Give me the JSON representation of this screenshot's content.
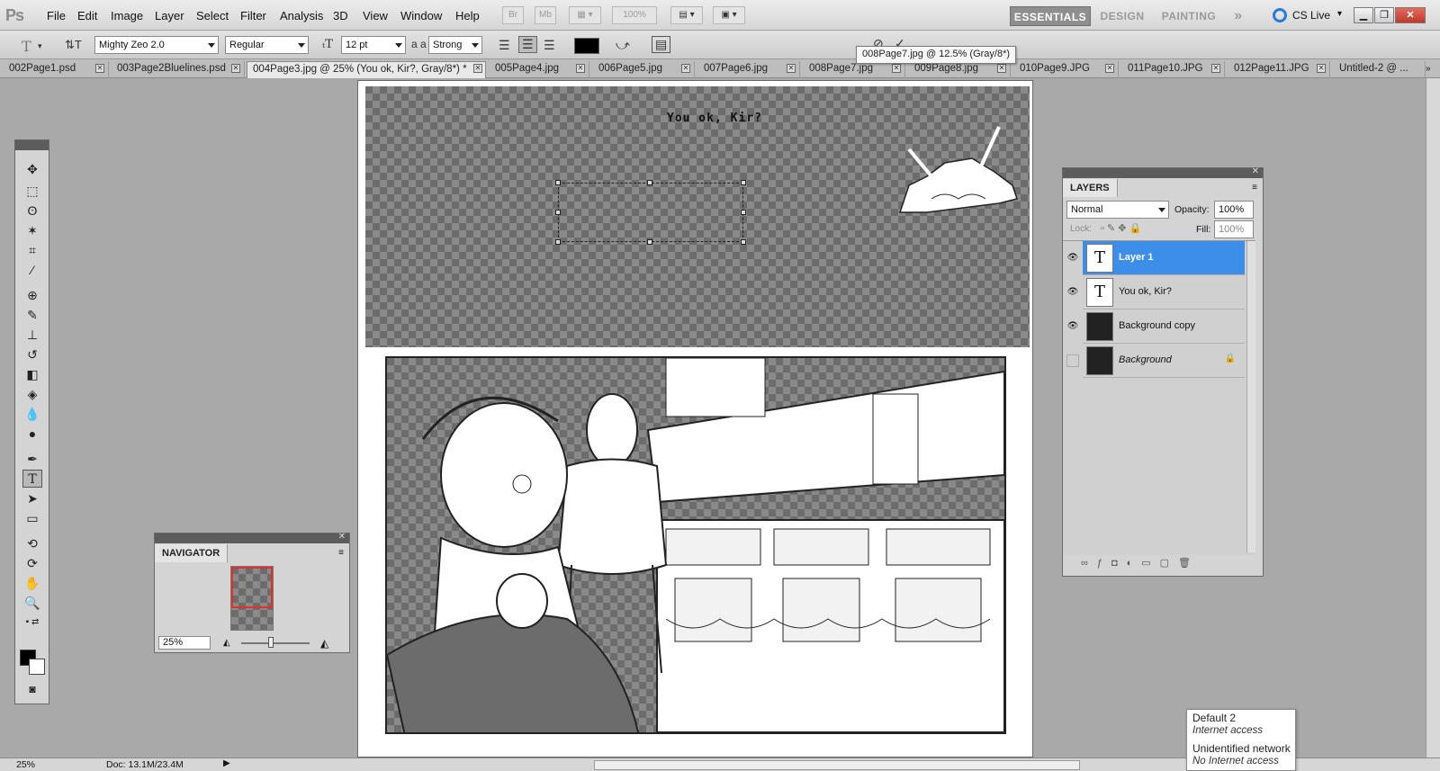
{
  "app": {
    "logo": "Ps"
  },
  "menu": [
    "File",
    "Edit",
    "Image",
    "Layer",
    "Select",
    "Filter",
    "Analysis",
    "3D",
    "View",
    "Window",
    "Help"
  ],
  "menubar": {
    "br_label": "Br",
    "mb_label": "Mb",
    "zoom": "100%"
  },
  "workspaces": {
    "essentials": "ESSENTIALS",
    "design": "DESIGN",
    "painting": "PAINTING",
    "more": "»",
    "cslive": "CS Live"
  },
  "options": {
    "tool_icon": "T",
    "font_family": "Mighty Zeo 2.0",
    "font_style": "Regular",
    "font_size": "12 pt",
    "aa_label": "a a",
    "antialias": "Strong",
    "text_color": "#000000"
  },
  "tooltip": "008Page7.jpg @ 12.5% (Gray/8*)",
  "tabs": [
    {
      "label": "002Page1.psd"
    },
    {
      "label": "003Page2Bluelines.psd"
    },
    {
      "label": "004Page3.jpg @ 25% (You ok, Kir?, Gray/8*) *"
    },
    {
      "label": "005Page4.jpg"
    },
    {
      "label": "006Page5.jpg"
    },
    {
      "label": "007Page6.jpg"
    },
    {
      "label": "008Page7.jpg"
    },
    {
      "label": "009Page8.jpg"
    },
    {
      "label": "010Page9.JPG"
    },
    {
      "label": "011Page10.JPG"
    },
    {
      "label": "012Page11.JPG"
    },
    {
      "label": "Untitled-2 @ ..."
    }
  ],
  "canvas": {
    "speech_text": "You ok, Kir?"
  },
  "navigator": {
    "title": "NAVIGATOR",
    "zoom": "25%"
  },
  "layers": {
    "title": "LAYERS",
    "blend_mode": "Normal",
    "opacity_label": "Opacity:",
    "opacity": "100%",
    "lock_label": "Lock:",
    "fill_label": "Fill:",
    "fill": "100%",
    "items": [
      {
        "name": "Layer 1",
        "thumb": "T",
        "visible": true,
        "selected": true
      },
      {
        "name": "You ok, Kir?",
        "thumb": "T",
        "visible": true,
        "selected": false
      },
      {
        "name": "Background copy",
        "thumb": "",
        "visible": true,
        "selected": false
      },
      {
        "name": "Background",
        "thumb": "",
        "visible": false,
        "selected": false
      }
    ]
  },
  "status": {
    "zoom": "25%",
    "doc": "Doc: 13.1M/23.4M"
  },
  "network": {
    "net1_name": "Default  2",
    "net1_status": "Internet access",
    "net2_name": "Unidentified network",
    "net2_status": "No Internet access"
  },
  "colors": {
    "accent": "#3d8ee8",
    "essentials_bg": "#8e8e8e"
  }
}
